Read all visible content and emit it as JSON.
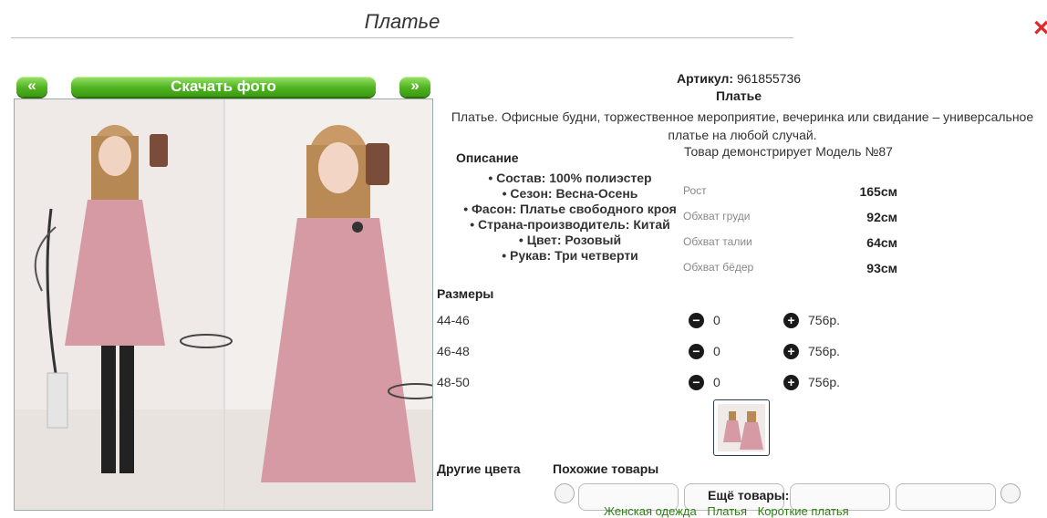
{
  "page_title": "Платье",
  "close_icon": "×",
  "gallery": {
    "prev_label": "«",
    "next_label": "»",
    "download_label": "Скачать фото"
  },
  "product": {
    "sku_label": "Артикул:",
    "sku_value": "961855736",
    "name": "Платье",
    "description": "Платье. Офисные будни, торжественное мероприятие, вечеринка или свидание – универсальное платье на любой случай.",
    "model_line": "Товар демонстрирует Модель №87"
  },
  "specs": {
    "heading": "Описание",
    "items": [
      "• Состав: 100% полиэстер",
      "• Сезон: Весна-Осень",
      "• Фасон: Платье свободного кроя",
      "• Страна-производитель: Китай",
      "• Цвет: Розовый",
      "• Рукав: Три четверти"
    ]
  },
  "measurements": [
    {
      "label": "Рост",
      "value": "165см"
    },
    {
      "label": "Обхват груди",
      "value": "92см"
    },
    {
      "label": "Обхват талии",
      "value": "64см"
    },
    {
      "label": "Обхват бёдер",
      "value": "93см"
    }
  ],
  "sizes": {
    "heading": "Размеры",
    "rows": [
      {
        "size": "44-46",
        "qty": "0",
        "price": "756р."
      },
      {
        "size": "46-48",
        "qty": "0",
        "price": "756р."
      },
      {
        "size": "48-50",
        "qty": "0",
        "price": "756р."
      }
    ],
    "minus_icon": "−",
    "plus_icon": "+"
  },
  "bottom": {
    "other_colors": "Другие цвета",
    "similar": "Похожие товары",
    "more_goods": "Ещё товары:",
    "more_links": [
      "Женская одежда",
      "Платья",
      "Короткие платья"
    ]
  },
  "colors": {
    "accent_green": "#4fb320",
    "dress_pink": "#d59aa3",
    "close_red": "#e02a2a"
  }
}
